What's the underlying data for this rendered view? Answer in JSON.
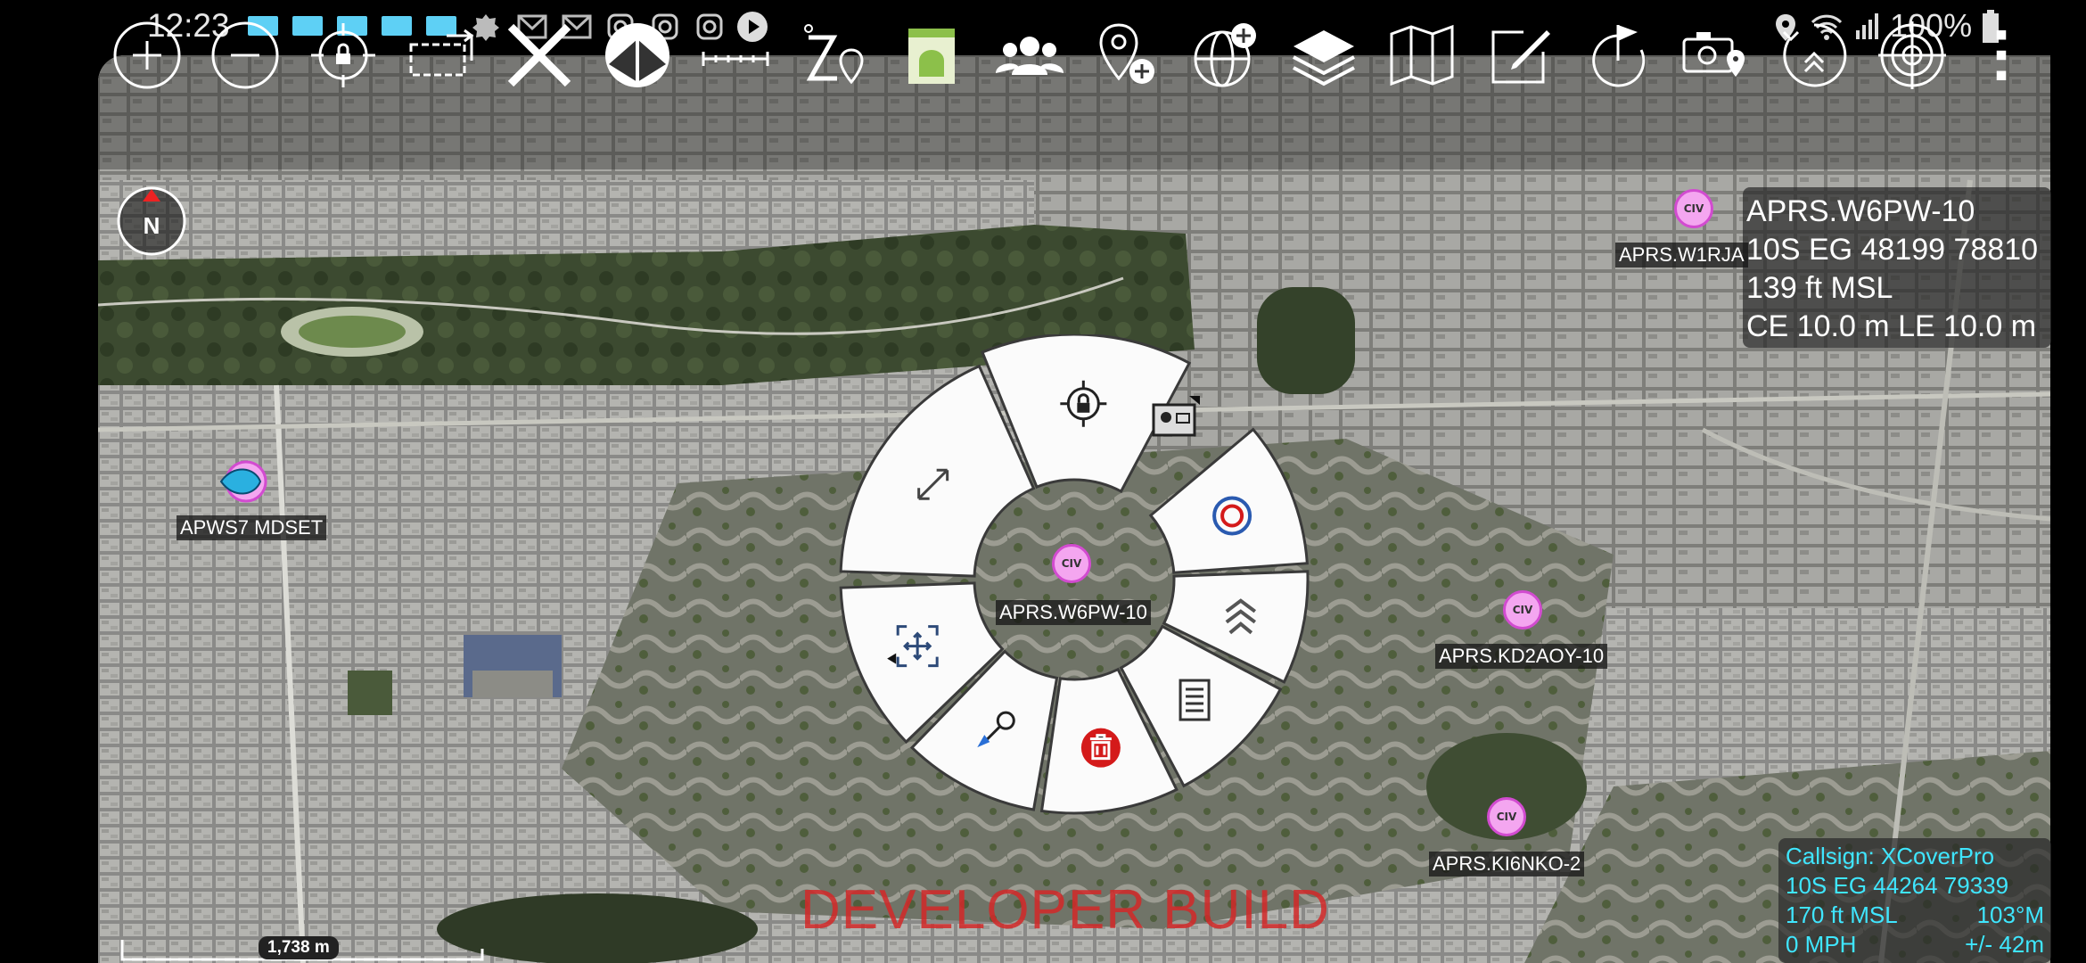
{
  "status_bar": {
    "time": "12:23",
    "battery": "100%",
    "icons": [
      "rect-notification-icon",
      "rect-notification-icon",
      "rect-notification-icon",
      "rect-notification-icon",
      "rect-notification-icon",
      "badge-icon",
      "mail-icon",
      "mail-icon",
      "instagram-icon",
      "instagram-icon",
      "instagram-icon",
      "play-icon",
      "location-icon",
      "wifi-icon",
      "signal-icon",
      "battery-icon"
    ]
  },
  "toolbar": {
    "items": [
      "zoom-in",
      "zoom-out",
      "lock-on-self",
      "overlay-toggle",
      "tools-close",
      "quick-pic",
      "measure",
      "bloodhound",
      "android-plugin",
      "contacts",
      "add-point",
      "globe-add",
      "layers",
      "map",
      "edit",
      "route",
      "camera-location",
      "nav",
      "target",
      "more"
    ]
  },
  "top_info": {
    "line1": "APRS.W6PW-10",
    "line2": "10S EG 48199 78810",
    "line3": "139 ft MSL",
    "line4": "CE 10.0 m LE 10.0 m"
  },
  "self_info": {
    "callsign": "Callsign: XCoverPro",
    "mgrs": "10S  EG  44264  79339",
    "alt": "170 ft MSL",
    "heading": "103°M",
    "speed": "0 MPH",
    "accuracy": "+/- 42m"
  },
  "markers": {
    "civ_text": "CIV",
    "center": "APRS.W6PW-10",
    "kd2aoy": "APRS.KD2AOY-10",
    "ki6nko": "APRS.KI6NKO-2",
    "w1rja": "APRS.W1RJA",
    "left": "APWS7 MDSET"
  },
  "compass": {
    "letter": "N"
  },
  "scale": {
    "label": "1,738 m"
  },
  "watermark": "DEVELOPER BUILD",
  "radial_menu": {
    "items": [
      "lock-icon",
      "resize-icon",
      "pan-icon",
      "nav-to-icon",
      "delete-icon",
      "details-icon",
      "chevrons-icon",
      "target-icon"
    ]
  },
  "colors": {
    "accent_cyan": "#3fe6ff",
    "civ_pink": "#f4a6f0",
    "delete_red": "#d41a1a",
    "status_blue": "#5ed0f5"
  }
}
